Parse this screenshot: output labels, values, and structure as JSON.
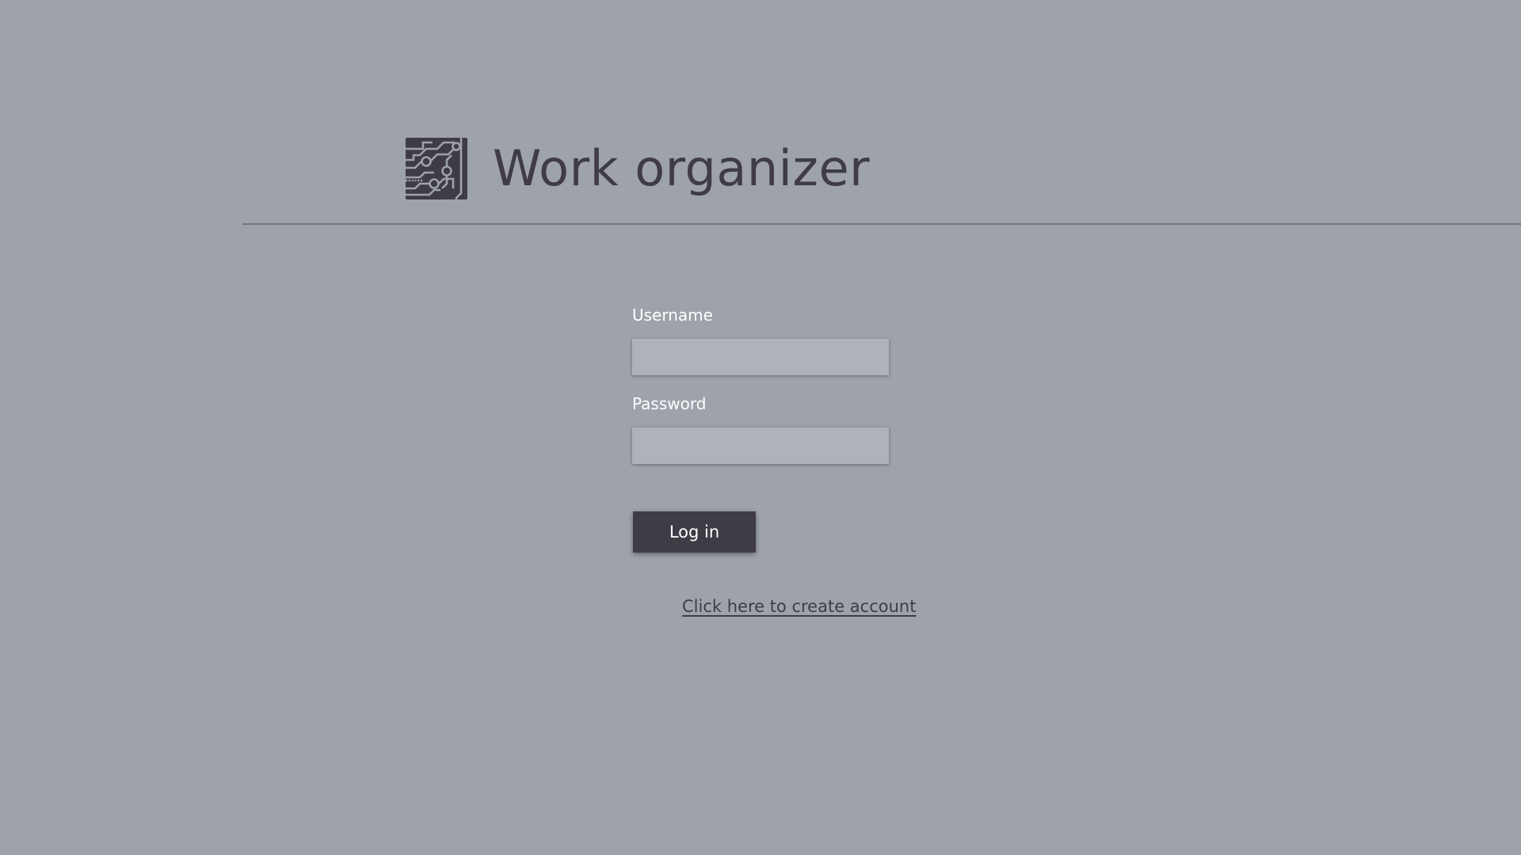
{
  "header": {
    "logo_icon": "circuit-board-icon",
    "title": "Work organizer"
  },
  "login_form": {
    "username_label": "Username",
    "username_value": "",
    "password_label": "Password",
    "password_value": "",
    "login_button_label": "Log in",
    "create_account_link": "Click here to create account"
  },
  "colors": {
    "background": "#9ea2ab",
    "primary_dark": "#3f3c45",
    "input_background": "#afb3b9",
    "divider": "#717580",
    "label_text": "#ffffff"
  }
}
